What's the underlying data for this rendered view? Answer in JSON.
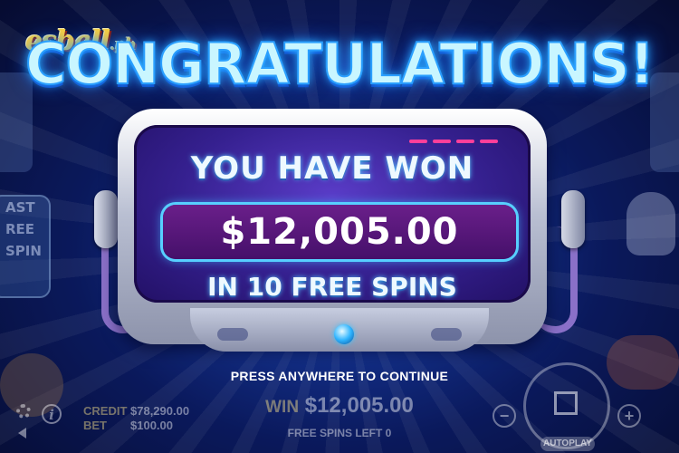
{
  "logo": {
    "brand": "esball",
    "suffix": ".ph"
  },
  "popup": {
    "title": "CONGRATULATIONS!",
    "won_label": "YOU HAVE WON",
    "amount": "$12,005.00",
    "spins_text": "IN 10 FREE SPINS",
    "continue_text": "PRESS ANYWHERE TO CONTINUE"
  },
  "side": {
    "free_spin_lines": [
      "AST",
      "REE",
      "SPIN"
    ]
  },
  "bottombar": {
    "credit_label": "CREDIT",
    "credit_value": "$78,290.00",
    "bet_label": "BET",
    "bet_value": "$100.00",
    "win_label": "WIN",
    "win_value": "$12,005.00",
    "free_spins_left": "FREE SPINS LEFT 0",
    "minus_label": "−",
    "plus_label": "+",
    "info_label": "i",
    "autoplay_label": "AUTOPLAY"
  },
  "icons": [
    "gear-icon",
    "info-icon",
    "sound-icon",
    "stop-icon"
  ],
  "colors": {
    "title_glow": "#2ab8ff",
    "screen": "#35208f",
    "amount_box": "#45106a",
    "logo": "#ffd23a"
  }
}
